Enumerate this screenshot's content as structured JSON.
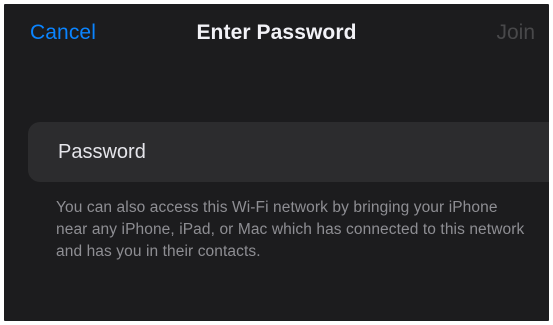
{
  "nav": {
    "cancel_label": "Cancel",
    "title": "Enter Password",
    "join_label": "Join"
  },
  "password_field": {
    "placeholder": "Password",
    "value": ""
  },
  "footer": {
    "note": "You can also access this Wi-Fi network by bringing your iPhone near any iPhone, iPad, or Mac which has connected to this network and has you in their contacts."
  },
  "colors": {
    "background": "#1c1c1e",
    "field": "#2c2c2e",
    "accent": "#0a84ff",
    "title": "#f2f2f7",
    "disabled": "#48484a",
    "secondary_text": "#8e8e93"
  }
}
